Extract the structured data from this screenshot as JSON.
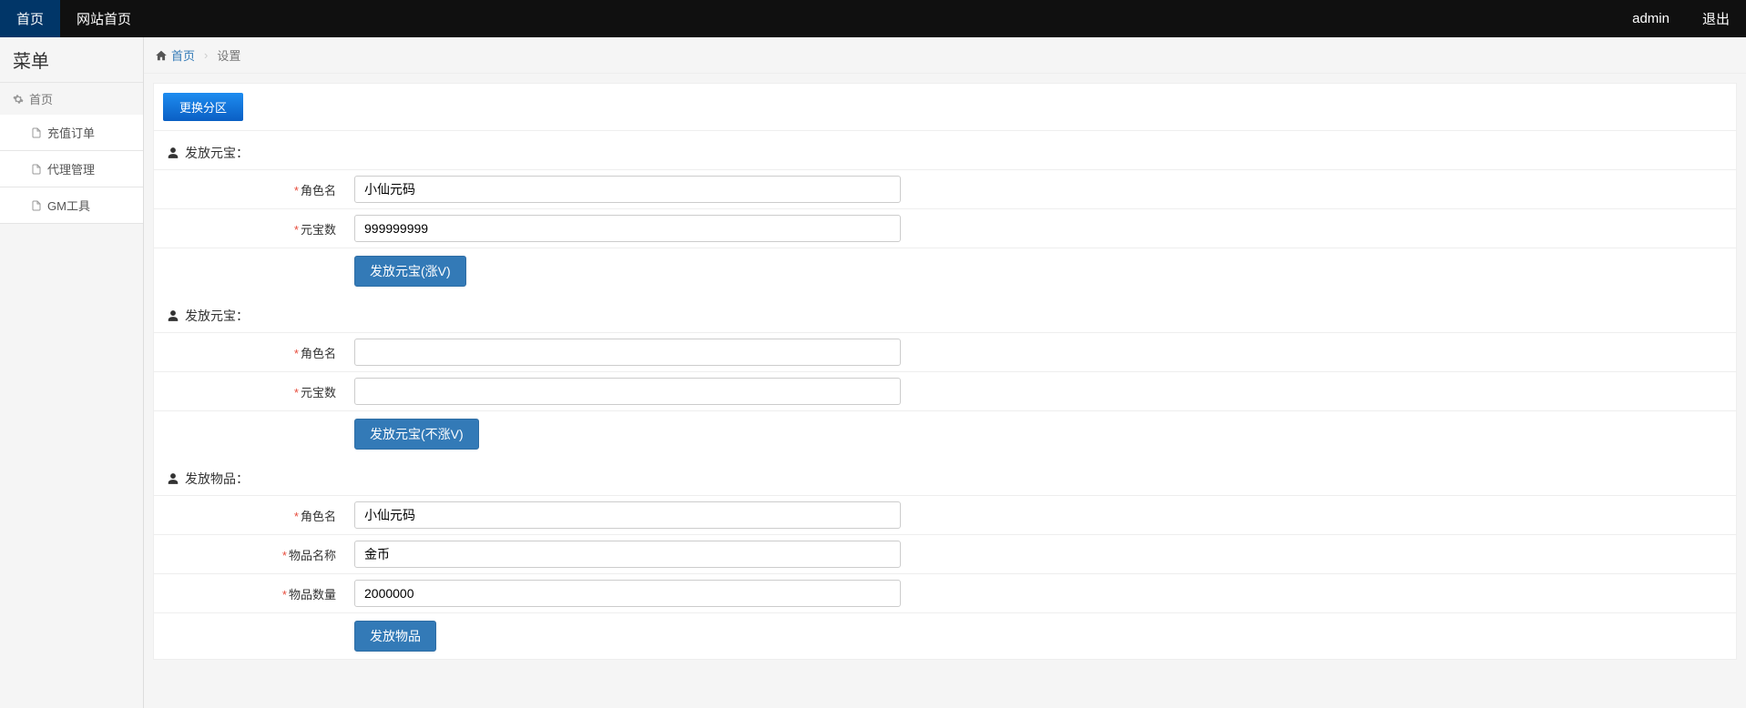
{
  "topbar": {
    "home": "首页",
    "site_home": "网站首页",
    "user": "admin",
    "logout": "退出"
  },
  "sidebar": {
    "title": "菜单",
    "section": "首页",
    "items": [
      {
        "label": "充值订单"
      },
      {
        "label": "代理管理"
      },
      {
        "label": "GM工具"
      }
    ]
  },
  "breadcrumb": {
    "home": "首页",
    "current": "设置"
  },
  "switch_zone": "更换分区",
  "sections": [
    {
      "title": "发放元宝：",
      "fields": [
        {
          "label": "角色名",
          "value": "小仙元码"
        },
        {
          "label": "元宝数",
          "value": "999999999"
        }
      ],
      "button": "发放元宝(涨V)"
    },
    {
      "title": "发放元宝：",
      "fields": [
        {
          "label": "角色名",
          "value": ""
        },
        {
          "label": "元宝数",
          "value": ""
        }
      ],
      "button": "发放元宝(不涨V)"
    },
    {
      "title": "发放物品：",
      "fields": [
        {
          "label": "角色名",
          "value": "小仙元码"
        },
        {
          "label": "物品名称",
          "value": "金币"
        },
        {
          "label": "物品数量",
          "value": "2000000"
        }
      ],
      "button": "发放物品"
    }
  ]
}
